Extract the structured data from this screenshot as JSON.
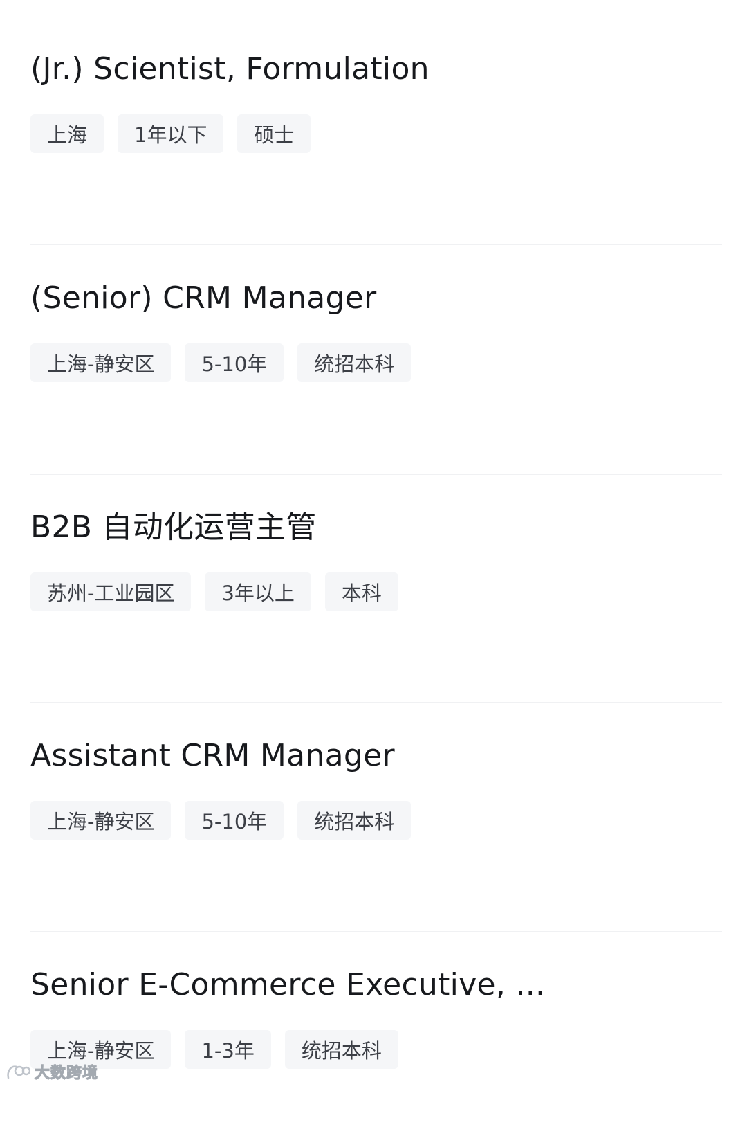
{
  "jobs": [
    {
      "title": "(Jr.) Scientist, Formulation",
      "tags": [
        "上海",
        "1年以下",
        "硕士"
      ]
    },
    {
      "title": "(Senior) CRM Manager",
      "tags": [
        "上海-静安区",
        "5-10年",
        "统招本科"
      ]
    },
    {
      "title": "B2B 自动化运营主管",
      "tags": [
        "苏州-工业园区",
        "3年以上",
        "本科"
      ]
    },
    {
      "title": "Assistant CRM Manager",
      "tags": [
        "上海-静安区",
        "5-10年",
        "统招本科"
      ]
    },
    {
      "title": "Senior E-Commerce Executive, ...",
      "tags": [
        "上海-静安区",
        "1-3年",
        "统招本科"
      ]
    }
  ],
  "watermark": {
    "text": "大数跨境",
    "icon": "watermark-logo-icon"
  }
}
